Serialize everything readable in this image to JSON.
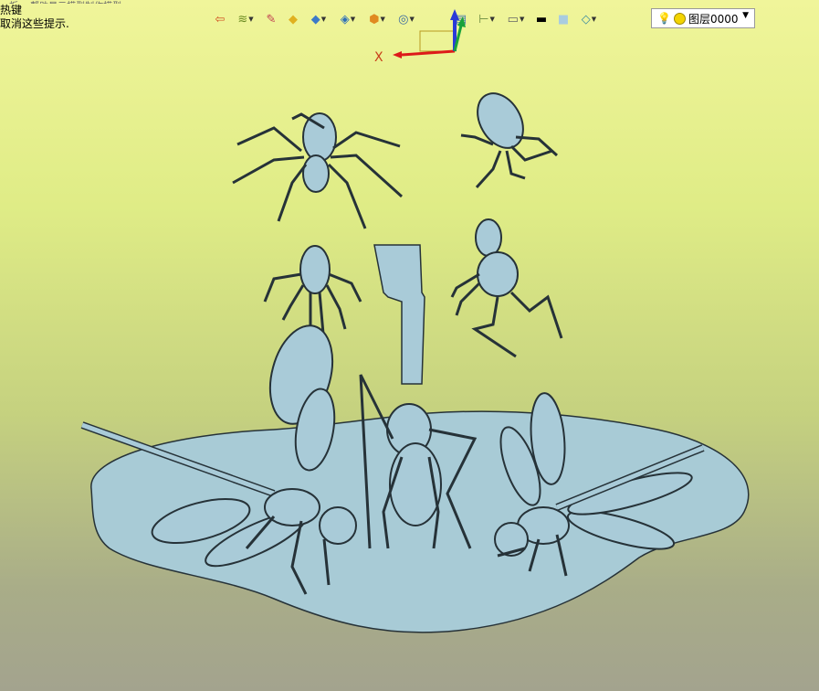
{
  "hint": {
    "line0": "…板     …帮助显示模型制作模型",
    "line1": "热键",
    "line2": "取消这些提示."
  },
  "toolbar": {
    "buttons": [
      {
        "name": "exit-icon",
        "glyph": "⇦",
        "color": "#d05020"
      },
      {
        "name": "layers-tool-icon",
        "glyph": "≋",
        "color": "#6a8a20",
        "dropdown": true
      },
      {
        "name": "pen-tool-icon",
        "glyph": "✎",
        "color": "#c04050"
      },
      {
        "name": "box-yellow-icon",
        "glyph": "◆",
        "color": "#e0b020"
      },
      {
        "name": "box-blue-icon",
        "glyph": "◆",
        "color": "#3c7ac8",
        "dropdown": true
      },
      {
        "name": "shape-tool-icon",
        "glyph": "◈",
        "color": "#2d6fb8",
        "dropdown": true
      },
      {
        "name": "polyhedron-icon",
        "glyph": "⬢",
        "color": "#e08a20",
        "dropdown": true
      },
      {
        "name": "view-select-icon",
        "glyph": "◎",
        "color": "#3a6aa0",
        "dropdown": true
      },
      {
        "name": "sheet-icon",
        "glyph": "▤",
        "color": "#4a7ab0"
      },
      {
        "name": "dimension-icon",
        "glyph": "⊢",
        "color": "#6a8a40",
        "dropdown": true
      },
      {
        "name": "monitor-icon",
        "glyph": "▭",
        "color": "#666",
        "dropdown": true
      },
      {
        "name": "line-weight-icon",
        "glyph": "▬",
        "color": "#000"
      },
      {
        "name": "fill-color-icon",
        "glyph": "■",
        "color": "#a9cce0"
      },
      {
        "name": "layer-stack-icon",
        "glyph": "◇",
        "color": "#3a8aa0",
        "dropdown": true
      }
    ],
    "axis_x_label": "X",
    "layer_select": {
      "value": "图层0000"
    }
  },
  "colors": {
    "model_fill": "#a9cbd8",
    "model_stroke": "#263238",
    "base_fill": "#a8cbd6",
    "axis_red": "#dd1a1a",
    "axis_green": "#19a23b",
    "axis_blue": "#2a3ad8"
  }
}
